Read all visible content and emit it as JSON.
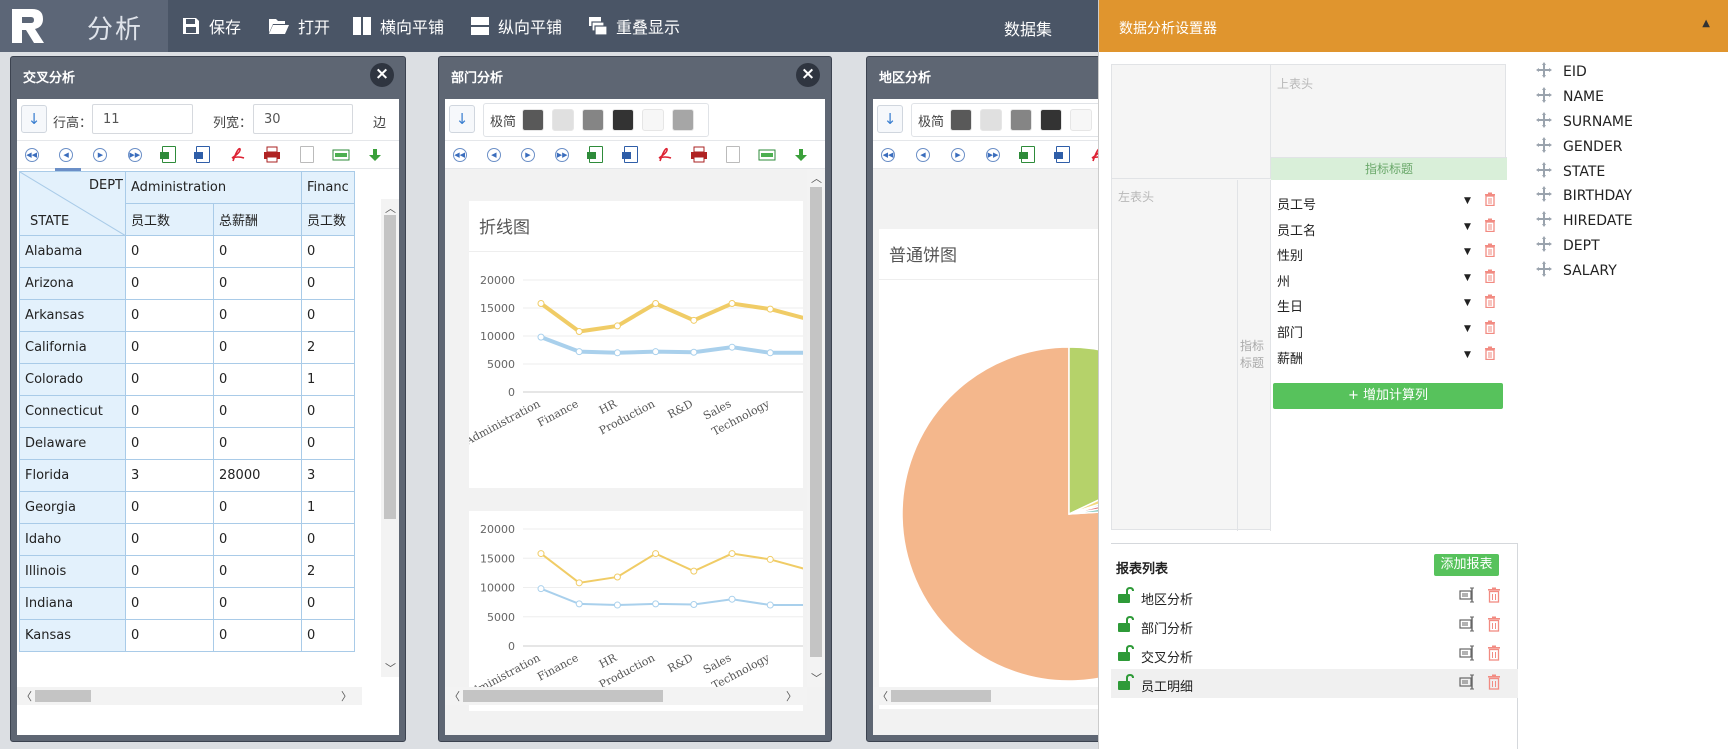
{
  "app": {
    "logo_letter": "R",
    "title": "分析",
    "toolbar": {
      "save": "保存",
      "open": "打开",
      "tile_h": "横向平铺",
      "tile_v": "纵向平铺",
      "overlap": "重叠显示",
      "dataset": "数据集"
    }
  },
  "colors": {
    "topbar": "#4a5566",
    "accent": "#e0952e",
    "green": "#57c25c",
    "line_series_1": "#f0cc66",
    "line_series_2": "#a9d0ec",
    "pie_main": "#f4b78c",
    "pie_second": "#b5d26a"
  },
  "cross_panel": {
    "title": "交叉分析",
    "close": "×",
    "row_height_label": "行高：",
    "row_height_value": "11",
    "col_width_label": "列宽：",
    "col_width_value": "30",
    "edge_label": "边",
    "dept_label": "DEPT",
    "state_label": "STATE",
    "dept_groups": [
      "Administration",
      "Financ"
    ],
    "sub_headers": [
      "员工数",
      "总薪酬",
      "员工数"
    ],
    "rows": [
      {
        "state": "Alabama",
        "v": [
          "0",
          "0",
          "0"
        ]
      },
      {
        "state": "Arizona",
        "v": [
          "0",
          "0",
          "0"
        ]
      },
      {
        "state": "Arkansas",
        "v": [
          "0",
          "0",
          "0"
        ]
      },
      {
        "state": "California",
        "v": [
          "0",
          "0",
          "2"
        ]
      },
      {
        "state": "Colorado",
        "v": [
          "0",
          "0",
          "1"
        ]
      },
      {
        "state": "Connecticut",
        "v": [
          "0",
          "0",
          "0"
        ]
      },
      {
        "state": "Delaware",
        "v": [
          "0",
          "0",
          "0"
        ]
      },
      {
        "state": "Florida",
        "v": [
          "3",
          "28000",
          "3"
        ]
      },
      {
        "state": "Georgia",
        "v": [
          "0",
          "0",
          "1"
        ]
      },
      {
        "state": "Idaho",
        "v": [
          "0",
          "0",
          "0"
        ]
      },
      {
        "state": "Illinois",
        "v": [
          "0",
          "0",
          "2"
        ]
      },
      {
        "state": "Indiana",
        "v": [
          "0",
          "0",
          "0"
        ]
      },
      {
        "state": "Kansas",
        "v": [
          "0",
          "0",
          "0"
        ]
      }
    ]
  },
  "dept_panel": {
    "title": "部门分析",
    "close": "×",
    "theme_label": "极简",
    "chart1_title": "折线图"
  },
  "region_panel": {
    "title": "地区分析",
    "theme_label": "极简",
    "chart_title": "普通饼图"
  },
  "chart_data": [
    {
      "type": "line",
      "title": "折线图",
      "categories": [
        "Administration",
        "Finance",
        "HR",
        "Production",
        "R&D",
        "Sales",
        "Technology"
      ],
      "yticks": [
        "20000",
        "15000",
        "10000",
        "5000",
        "0"
      ],
      "ylim": [
        0,
        20000
      ],
      "series": [
        {
          "values": [
            15800,
            10800,
            11800,
            15800,
            12800,
            15800,
            14800,
            13000
          ]
        },
        {
          "values": [
            9800,
            7200,
            7000,
            7200,
            7100,
            8000,
            7000,
            7000
          ]
        }
      ]
    },
    {
      "type": "line",
      "categories": [
        "Administration",
        "Finance",
        "HR",
        "Production",
        "R&D",
        "Sales",
        "Technology"
      ],
      "yticks": [
        "20000",
        "15000",
        "10000",
        "5000",
        "0"
      ],
      "ylim": [
        0,
        20000
      ],
      "series": [
        {
          "values": [
            15800,
            10800,
            11800,
            15800,
            12800,
            15800,
            14800,
            13000
          ]
        },
        {
          "values": [
            9800,
            7200,
            7000,
            7200,
            7100,
            8000,
            7000,
            7000
          ]
        }
      ]
    },
    {
      "type": "pie",
      "title": "普通饼图",
      "values": [
        76,
        18,
        2,
        1,
        1.5,
        1.5
      ]
    }
  ],
  "settings": {
    "title": "数据分析设置器",
    "caret": "▲",
    "top_header_hint": "上表头",
    "left_header_hint": "左表头",
    "index_title_label": "指标标题",
    "index_title_side": "指标\n标题",
    "fields": [
      "员工号",
      "员工名",
      "性别",
      "州",
      "生日",
      "部门",
      "薪酬"
    ],
    "add_calc": "+ 增加计算列",
    "report_list_title": "报表列表",
    "add_report": "添加报表",
    "reports": [
      "地区分析",
      "部门分析",
      "交叉分析",
      "员工明细"
    ],
    "columns": [
      "EID",
      "NAME",
      "SURNAME",
      "GENDER",
      "STATE",
      "BIRTHDAY",
      "HIREDATE",
      "DEPT",
      "SALARY"
    ]
  }
}
